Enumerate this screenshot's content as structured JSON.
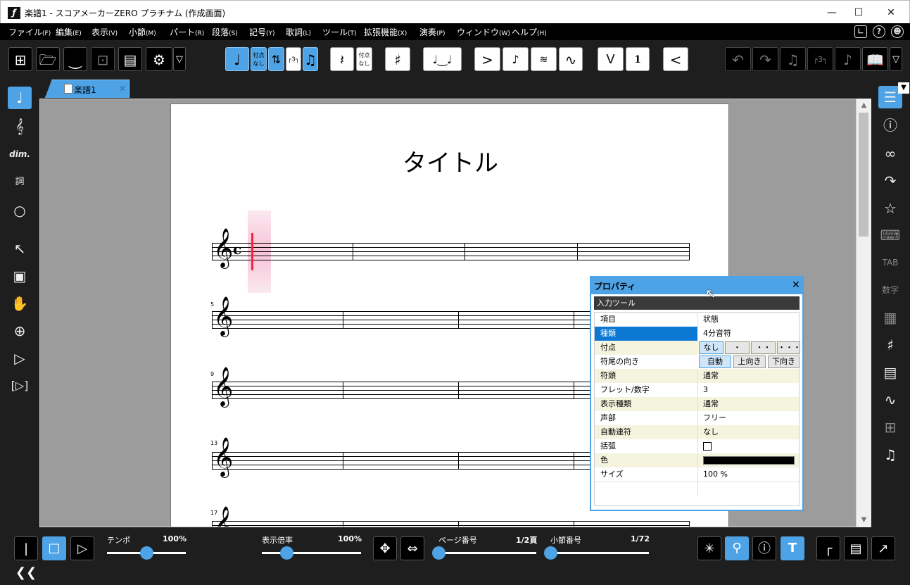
{
  "window": {
    "title": "楽譜1 - スコアメーカーZERO プラチナム (作成画面)",
    "app_icon": "ƒ"
  },
  "menu": [
    {
      "label": "ファイル",
      "key": "(F)"
    },
    {
      "label": "編集",
      "key": "(E)"
    },
    {
      "label": "表示",
      "key": "(V)"
    },
    {
      "label": "小節",
      "key": "(M)"
    },
    {
      "label": "パート",
      "key": "(R)"
    },
    {
      "label": "段落",
      "key": "(S)"
    },
    {
      "label": "記号",
      "key": "(Y)"
    },
    {
      "label": "歌詞",
      "key": "(L)"
    },
    {
      "label": "ツール",
      "key": "(T)"
    },
    {
      "label": "拡張機能",
      "key": "(X)"
    },
    {
      "label": "演奏",
      "key": "(P)"
    },
    {
      "label": "ウィンドウ",
      "key": "(W)"
    },
    {
      "label": "ヘルプ",
      "key": "(H)"
    }
  ],
  "toolbar": {
    "dot_none_1": "付点",
    "dot_none_2": "なし",
    "rest_dot_1": "付点",
    "rest_dot_2": "なし",
    "tuplet": "┌3┐",
    "number_one": "1"
  },
  "tabs": [
    {
      "label": "楽譜1"
    }
  ],
  "score": {
    "title": "タイトル",
    "measure_numbers": [
      "5",
      "9",
      "13",
      "17"
    ],
    "time_signature": "c"
  },
  "properties": {
    "title": "プロパティ",
    "subtitle": "入力ツール",
    "col_item": "項目",
    "col_state": "状態",
    "rows": [
      {
        "key": "種類",
        "value": "4分音符"
      },
      {
        "key": "付点",
        "value": ""
      },
      {
        "key": "符尾の向き",
        "value": ""
      },
      {
        "key": "符頭",
        "value": "通常"
      },
      {
        "key": "フレット/数字",
        "value": "3"
      },
      {
        "key": "表示種類",
        "value": "通常"
      },
      {
        "key": "声部",
        "value": "フリー"
      },
      {
        "key": "自動連符",
        "value": "なし"
      },
      {
        "key": "括弧",
        "value": ""
      },
      {
        "key": "色",
        "value": ""
      },
      {
        "key": "サイズ",
        "value": "100 %"
      }
    ],
    "dot_options": [
      "なし",
      "・",
      "・・",
      "・・・"
    ],
    "stem_options": [
      "自動",
      "上向き",
      "下向き"
    ],
    "color_value": "#000000"
  },
  "status": {
    "tempo_label": "テンポ",
    "tempo_value": "100%",
    "tempo_fraction": 0.5,
    "zoom_label": "表示倍率",
    "zoom_value": "100%",
    "zoom_fraction": 0.25,
    "page_label": "ページ番号",
    "page_value": "1/2頁",
    "page_fraction": 0.0,
    "measure_label": "小節番号",
    "measure_value": "1/72",
    "measure_fraction": 0.0
  }
}
